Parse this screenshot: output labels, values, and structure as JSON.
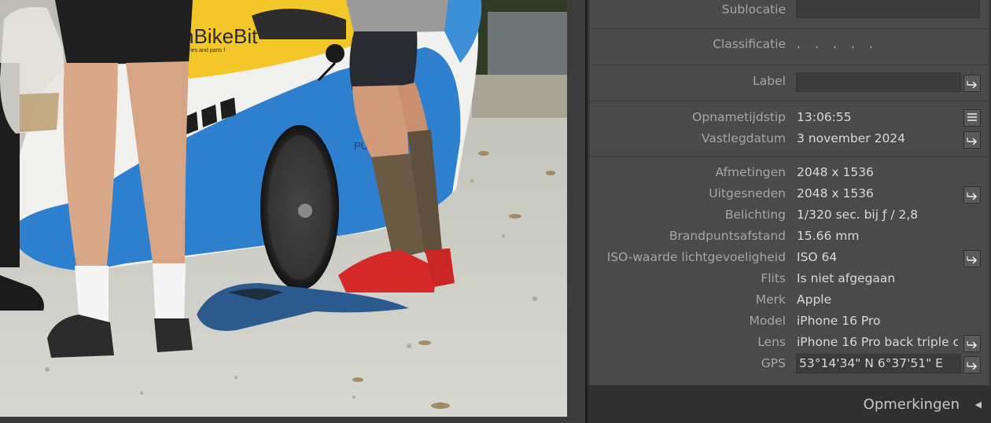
{
  "photo": {
    "logo_text": "nBikeBit",
    "logo_subtext": "ories and parts f",
    "side_text": "PU"
  },
  "metadata": {
    "sublocatie": {
      "label": "Sublocatie",
      "value": ""
    },
    "classificatie": {
      "label": "Classificatie",
      "rating": [
        ".",
        ".",
        ".",
        ".",
        "."
      ]
    },
    "label": {
      "label": "Label",
      "value": ""
    },
    "opnametijdstip": {
      "label": "Opnametijdstip",
      "value": "13:06:55"
    },
    "vastlegdatum": {
      "label": "Vastlegdatum",
      "value": "3 november 2024"
    },
    "afmetingen": {
      "label": "Afmetingen",
      "value": "2048 x 1536"
    },
    "uitgesneden": {
      "label": "Uitgesneden",
      "value": "2048 x 1536"
    },
    "belichting": {
      "label": "Belichting",
      "value": "1/320 sec. bij ƒ / 2,8"
    },
    "brandpuntsafstand": {
      "label": "Brandpuntsafstand",
      "value": "15.66 mm"
    },
    "iso": {
      "label": "ISO-waarde lichtgevoeligheid",
      "value": "ISO 64"
    },
    "flits": {
      "label": "Flits",
      "value": "Is niet afgegaan"
    },
    "merk": {
      "label": "Merk",
      "value": "Apple"
    },
    "model": {
      "label": "Model",
      "value": "iPhone 16 Pro"
    },
    "lens": {
      "label": "Lens",
      "value": "iPhone 16 Pro back triple c"
    },
    "gps": {
      "label": "GPS",
      "value": "53°14'34\" N 6°37'51\" E"
    }
  },
  "footer": {
    "label": "Opmerkingen",
    "arrow": "◀"
  },
  "icons": {
    "go_arrow": "arrow-right-icon",
    "list": "list-icon",
    "collapse": "triangle-left-icon"
  }
}
